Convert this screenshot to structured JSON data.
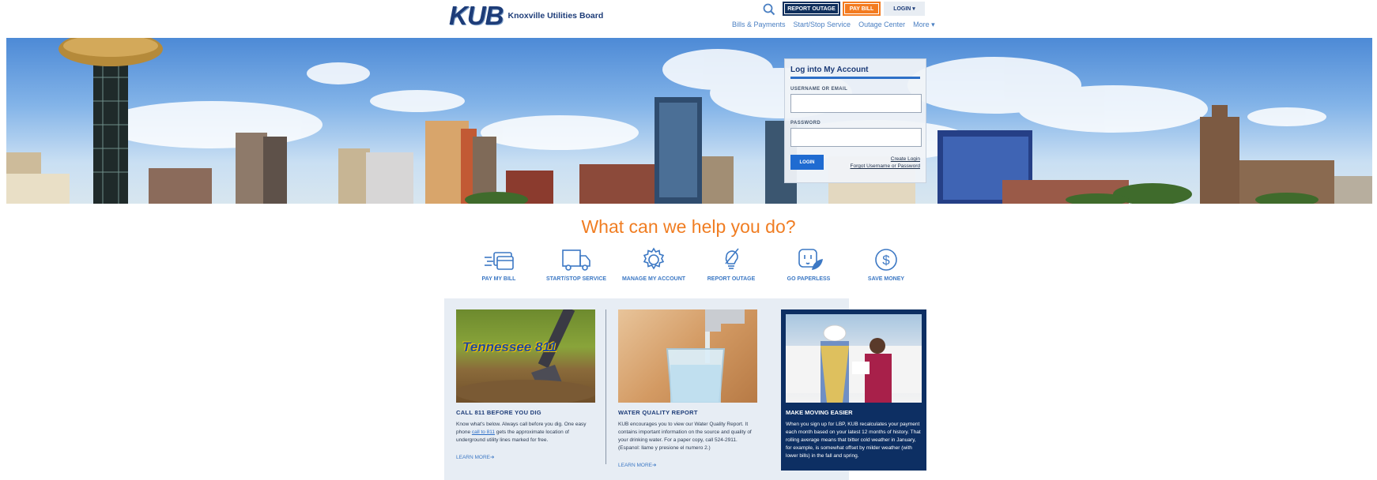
{
  "header": {
    "logo_mark": "KUB",
    "logo_text": "Knoxville Utilities Board",
    "buttons": {
      "report_outage": "REPORT OUTAGE",
      "pay_bill": "PAY BILL",
      "login": "LOGIN ▾"
    },
    "nav": [
      "Bills & Payments",
      "Start/Stop Service",
      "Outage Center",
      "More ▾"
    ]
  },
  "login_panel": {
    "title": "Log into My Account",
    "username_label": "USERNAME OR EMAIL",
    "password_label": "PASSWORD",
    "login_button": "LOGIN",
    "create_login": "Create Login",
    "forgot": "Forgot Username or Password"
  },
  "help": {
    "title": "What can we help you do?",
    "actions": [
      {
        "label": "PAY MY BILL",
        "icon": "credit-card-icon"
      },
      {
        "label": "START/STOP SERVICE",
        "icon": "truck-icon"
      },
      {
        "label": "MANAGE MY ACCOUNT",
        "icon": "gear-icon"
      },
      {
        "label": "REPORT OUTAGE",
        "icon": "lightbulb-icon"
      },
      {
        "label": "GO PAPERLESS",
        "icon": "outlet-leaf-icon"
      },
      {
        "label": "SAVE MONEY",
        "icon": "dollar-icon"
      }
    ]
  },
  "cards": [
    {
      "title": "CALL 811 BEFORE YOU DIG",
      "text_before_link": "Know what's below. Always call before you dig. One easy phone ",
      "link": "call to 811",
      "text_after_link": " gets the approximate location of underground utility lines marked for free.",
      "more": "LEARN MORE➔",
      "image_text": "Tennessee 811"
    },
    {
      "title": "WATER QUALITY REPORT",
      "text": "KUB encourages you to view our Water Quality Report. It contains important information on the source and quality of your drinking water. For a paper copy, call 524-2911. (Espanol: llame y presione el numero 2.)",
      "more": "LEARN MORE➔"
    },
    {
      "title": "MAKE MOVING EASIER",
      "text": "When you sign up for LBP, KUB recalculates your payment each month based on your latest 12 months of history. That rolling average means that bitter cold weather in January, for example, is somewhat offset by milder weather (with lower bills) in the fall and spring."
    }
  ],
  "colors": {
    "navy": "#0f2f5c",
    "orange": "#f37b20",
    "link_blue": "#3c78c4",
    "card_bg": "#e7edf4"
  }
}
